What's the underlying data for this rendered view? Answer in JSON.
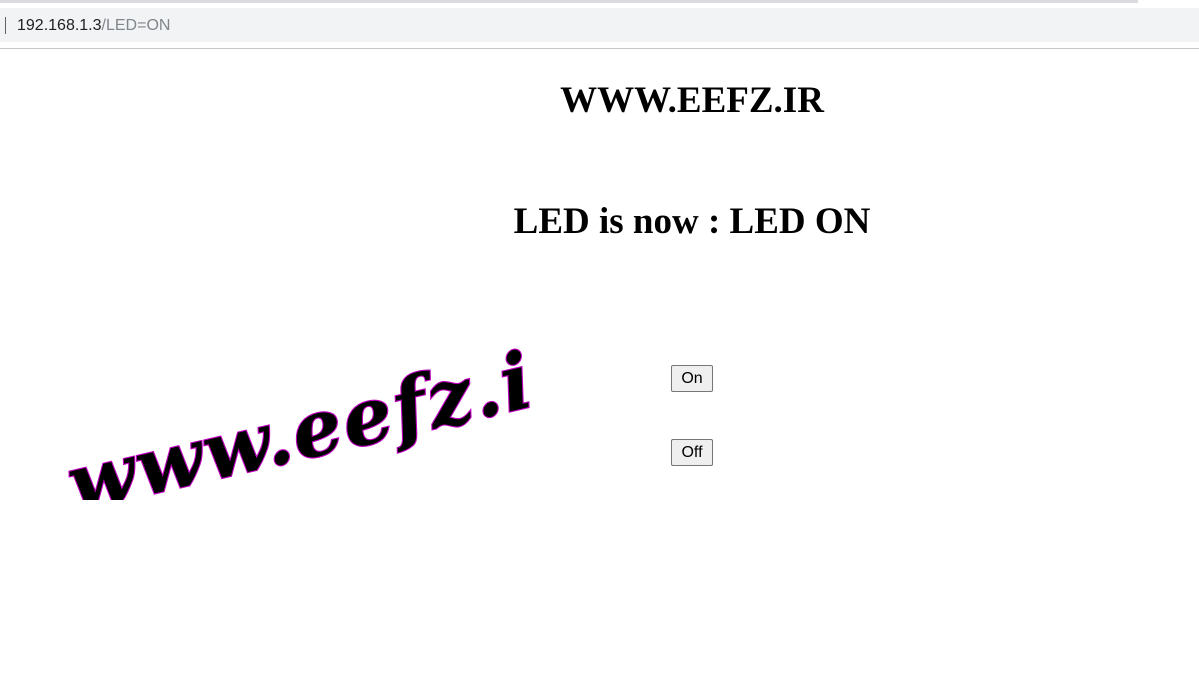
{
  "browser": {
    "url_host": "192.168.1.3",
    "url_path": "/LED=ON"
  },
  "page": {
    "site_title": "WWW.EEFZ.IR",
    "status_text": "LED is now : LED ON",
    "logo_text": "www.eefz.ir",
    "buttons": {
      "on_label": "On",
      "off_label": "Off"
    }
  },
  "colors": {
    "logo_fill": "#000000",
    "logo_outline": "#c000c0",
    "background": "#ffffff"
  }
}
